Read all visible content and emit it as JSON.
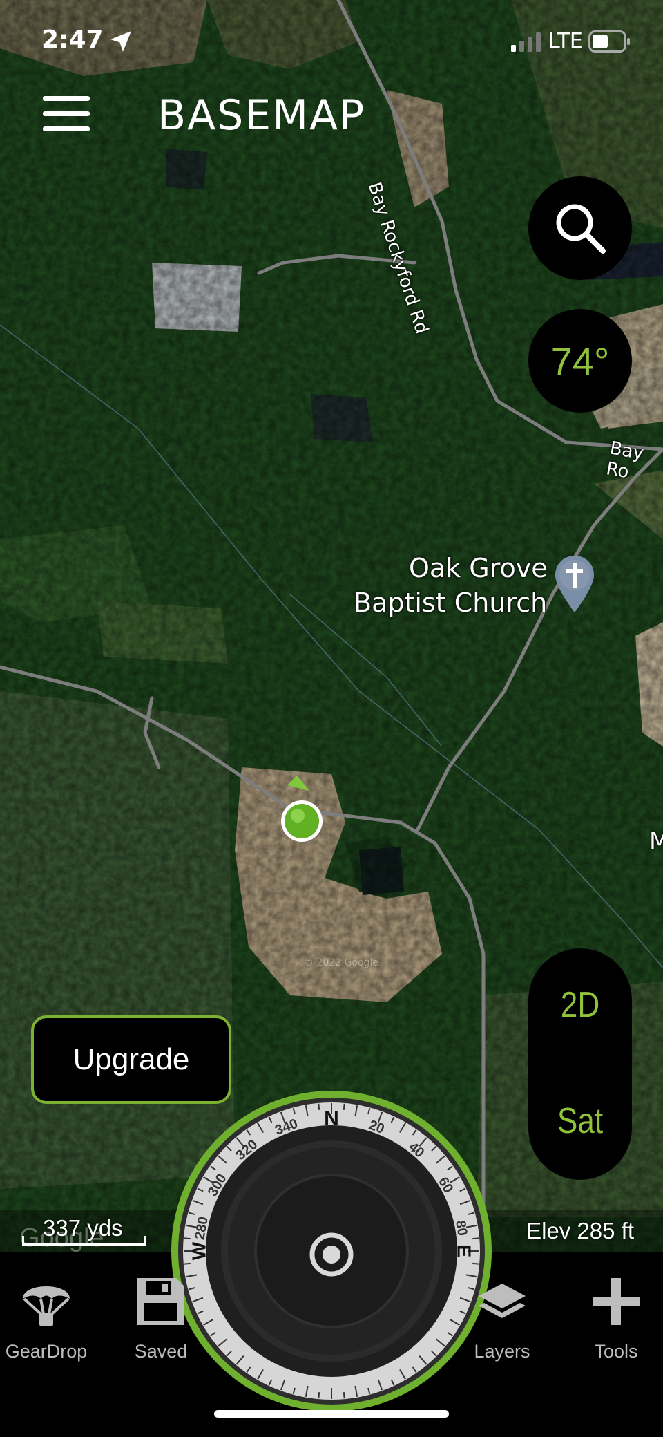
{
  "status_bar": {
    "time": "2:47",
    "network": "LTE"
  },
  "app": {
    "logo_text": "BASEMAP"
  },
  "weather": {
    "temperature": "74°"
  },
  "map": {
    "road_label_1": "Bay Rockyford Rd",
    "road_label_2": "Bay Ro",
    "poi_line_1": "Oak Grove",
    "poi_line_2": "Baptist Church",
    "edge_label": "M",
    "copyright": "© 2022 Google",
    "google_mark": "Google",
    "scale": "337 yds",
    "elevation": "Elev 285 ft"
  },
  "view_toggle": {
    "mode": "2D",
    "layer": "Sat"
  },
  "upgrade_label": "Upgrade",
  "compass": {
    "ticks": [
      "280",
      "300",
      "320",
      "340",
      "N",
      "20",
      "40",
      "60",
      "80"
    ],
    "west": "W",
    "east": "E"
  },
  "tabs": [
    {
      "label": "GearDrop",
      "icon": "parachute-icon"
    },
    {
      "label": "Saved",
      "icon": "floppy-disk-icon"
    },
    {
      "label": "Layers",
      "icon": "layers-icon"
    },
    {
      "label": "Tools",
      "icon": "plus-icon"
    }
  ],
  "colors": {
    "accent": "#8fc23a",
    "upgrade_border": "#7cb232"
  }
}
